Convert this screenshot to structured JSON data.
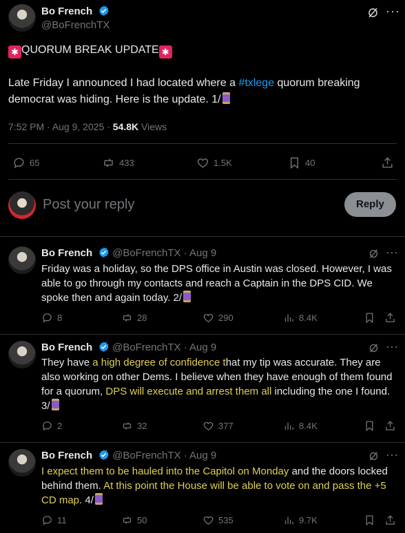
{
  "main_tweet": {
    "name": "Bo French",
    "handle": "@BoFrenchTX",
    "title_line": "QUORUM BREAK UPDATE",
    "text_before": "Late Friday I announced I had located where a ",
    "hashtag": "#txlege",
    "text_after": " quorum breaking democrat was hiding. Here is the update. 1/",
    "time": "7:52 PM",
    "date": "Aug 9, 2025",
    "views_count": "54.8K",
    "views_label": "Views",
    "replies": "65",
    "reposts": "433",
    "likes": "1.5K",
    "bookmarks": "40"
  },
  "composer": {
    "placeholder": "Post your reply",
    "reply_button": "Reply"
  },
  "replies": [
    {
      "name": "Bo French",
      "handle": "@BoFrenchTX",
      "date": "Aug 9",
      "text": "Friday was a holiday, so the DPS office in Austin was closed. However, I was able to go through my contacts and reach a Captain in the DPS CID. We spoke then and again today. 2/",
      "replies": "8",
      "reposts": "28",
      "likes": "290",
      "views": "8.4K"
    },
    {
      "name": "Bo French",
      "handle": "@BoFrenchTX",
      "date": "Aug 9",
      "text_a": "They have ",
      "hl_a": "a high degree of confidence t",
      "text_b": "hat my tip was accurate. They are also working on other Dems. I believe when they have enough of them found for a quorum, ",
      "hl_b": "DPS will execute and arrest them all",
      "text_c": " including the one I found. 3/",
      "replies": "2",
      "reposts": "32",
      "likes": "377",
      "views": "8.4K"
    },
    {
      "name": "Bo French",
      "handle": "@BoFrenchTX",
      "date": "Aug 9",
      "hl_a": "I expect them to be hauled into the Capitol on Monday",
      "text_a": " and the doors locked behind them. ",
      "hl_b": "At this point the House will be able to vote on and pass the +5 CD map.",
      "text_b": " 4/",
      "replies": "11",
      "reposts": "50",
      "likes": "535",
      "views": "9.7K"
    }
  ]
}
